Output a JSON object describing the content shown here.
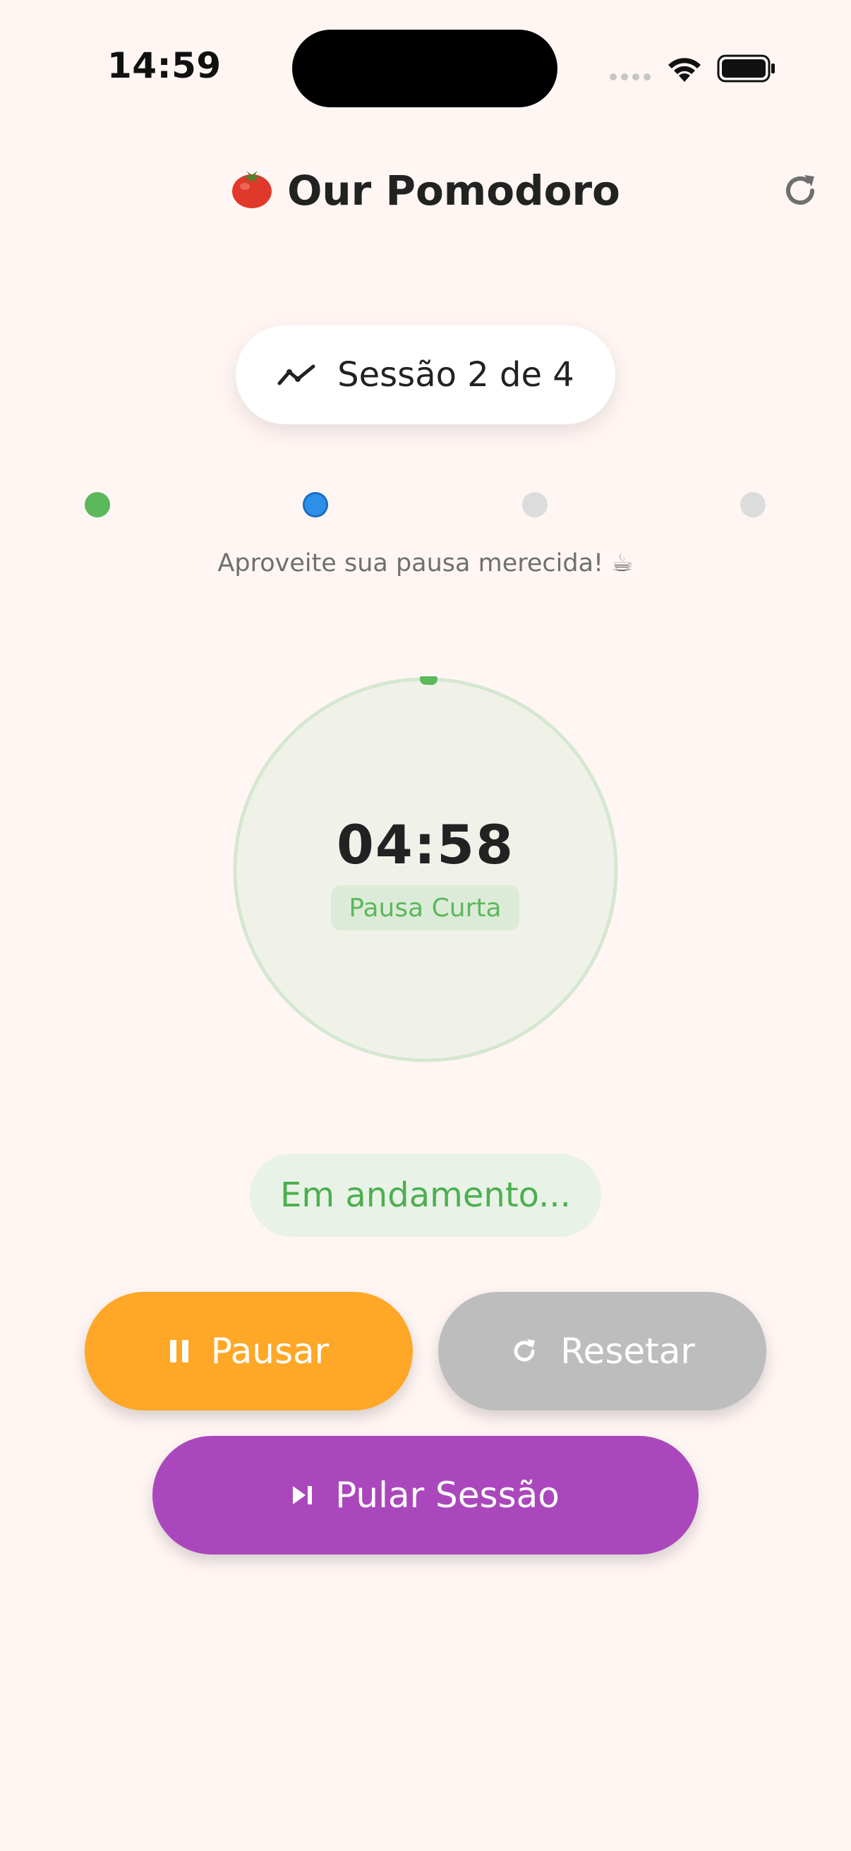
{
  "status_bar": {
    "time": "14:59"
  },
  "header": {
    "title": "Our Pomodoro",
    "logo_icon": "tomato-icon",
    "refresh_icon": "refresh-icon"
  },
  "session": {
    "label": "Sessão 2 de 4",
    "icon": "trending-line-icon",
    "current": 2,
    "total": 4,
    "dot_colors": [
      "#5cb85c",
      "#2c90e8",
      "#dcdcdc",
      "#dcdcdc"
    ]
  },
  "motivation": "Aproveite sua pausa merecida! ☕",
  "timer": {
    "time": "04:58",
    "mode": "Pausa Curta",
    "accent_color": "#5cb85c"
  },
  "status": "Em andamento...",
  "buttons": {
    "pause": {
      "label": "Pausar",
      "icon": "pause-icon",
      "color": "#ffa726"
    },
    "reset": {
      "label": "Resetar",
      "icon": "refresh-icon",
      "color": "#bdbdbd"
    },
    "skip": {
      "label": "Pular Sessão",
      "icon": "skip-next-icon",
      "color": "#ab47bc"
    }
  }
}
